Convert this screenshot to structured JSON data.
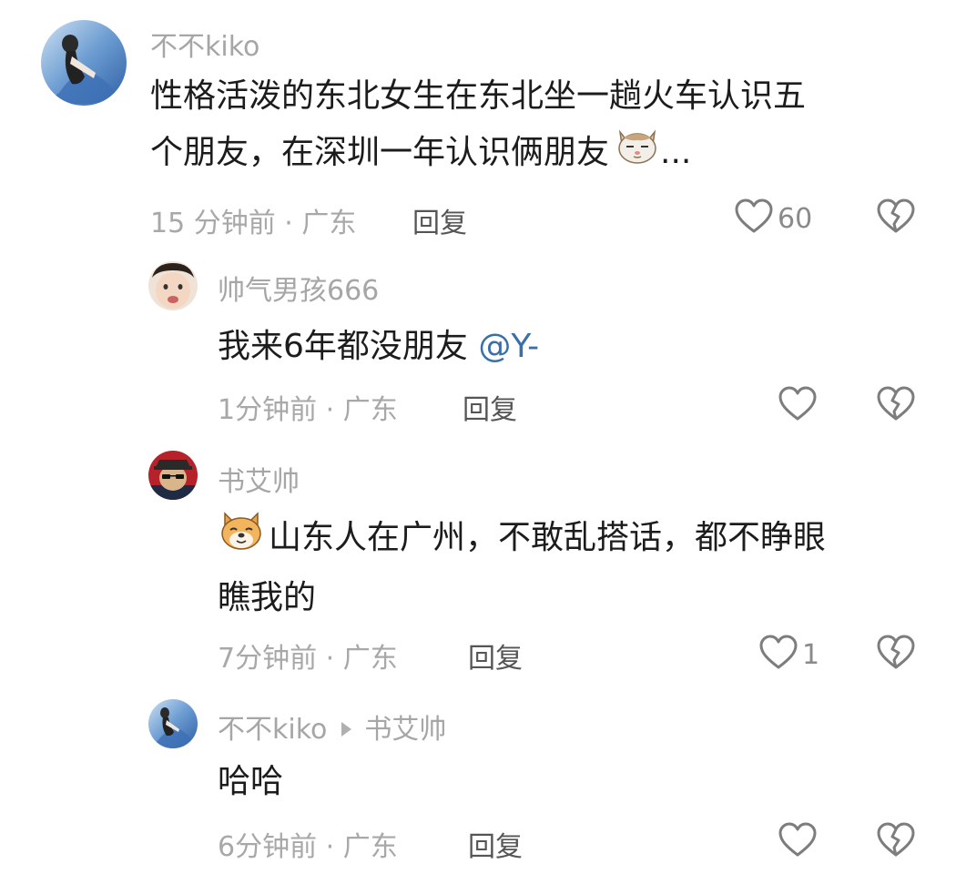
{
  "comments": [
    {
      "username": "不不kiko",
      "text_line1": "性格活泼的东北女生在东北坐一趟火车认识五",
      "text_line2": "个朋友，在深圳一年认识俩朋友",
      "text_ellipsis": "...",
      "meta": "15 分钟前 · 广东",
      "reply_label": "回复",
      "like_count": "60"
    },
    {
      "username": "帅气男孩666",
      "text": "我来6年都没朋友 ",
      "mention": "@Y-",
      "meta": "1分钟前 · 广东",
      "reply_label": "回复",
      "like_count": ""
    },
    {
      "username": "书艾帅",
      "text_line1": "山东人在广州，不敢乱搭话，都不睁眼",
      "text_line2": "瞧我的",
      "meta": "7分钟前 · 广东",
      "reply_label": "回复",
      "like_count": "1"
    },
    {
      "username": "不不kiko",
      "reply_to": "书艾帅",
      "text": "哈哈",
      "meta": "6分钟前 · 广东",
      "reply_label": "回复",
      "like_count": ""
    }
  ],
  "colors": {
    "username": "#a6a6a6",
    "mention": "#3b6fa8",
    "icon": "#7d7d7d"
  }
}
